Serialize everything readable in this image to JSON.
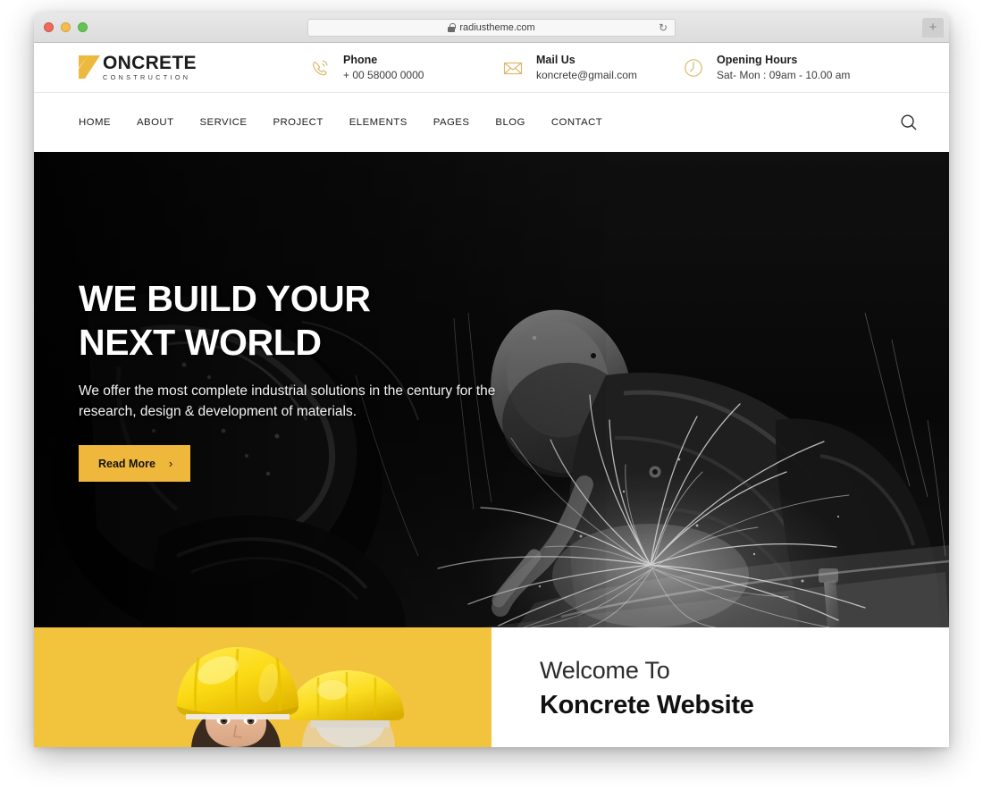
{
  "browser": {
    "url": "radiustheme.com",
    "lock_icon": "lock-icon",
    "reload_icon": "reload-icon",
    "newtab_label": "+",
    "traffic_lights": [
      "close",
      "minimize",
      "zoom"
    ]
  },
  "site": {
    "logo": {
      "mark": "K",
      "name": "ONCRETE",
      "tagline": "CONSTRUCTION",
      "accent_color": "#edb93e"
    },
    "info_items": [
      {
        "icon": "phone-icon",
        "title": "Phone",
        "value": "+ 00 58000 0000"
      },
      {
        "icon": "mail-icon",
        "title": "Mail Us",
        "value": "koncrete@gmail.com"
      },
      {
        "icon": "clock-icon",
        "title": "Opening Hours",
        "value": "Sat- Mon : 09am - 10.00 am"
      }
    ],
    "nav": {
      "items": [
        {
          "label": "HOME"
        },
        {
          "label": "ABOUT"
        },
        {
          "label": "SERVICE"
        },
        {
          "label": "PROJECT"
        },
        {
          "label": "ELEMENTS"
        },
        {
          "label": "PAGES"
        },
        {
          "label": "BLOG"
        },
        {
          "label": "CONTACT"
        }
      ],
      "search_icon": "search-icon"
    },
    "hero": {
      "title_line1": "WE BUILD YOUR",
      "title_line2": "NEXT WORLD",
      "subtitle": "We offer the most complete industrial solutions in the century for the research, design & development of materials.",
      "button_label": "Read More",
      "button_chevron": "›",
      "button_color": "#efb83c",
      "image_alt": "worker grinding metal with sparks, grayscale"
    },
    "welcome": {
      "panel_color": "#f2c33c",
      "image_alt": "two construction workers wearing yellow hard hats",
      "eyebrow": "Welcome To",
      "heading": "Koncrete Website"
    }
  }
}
